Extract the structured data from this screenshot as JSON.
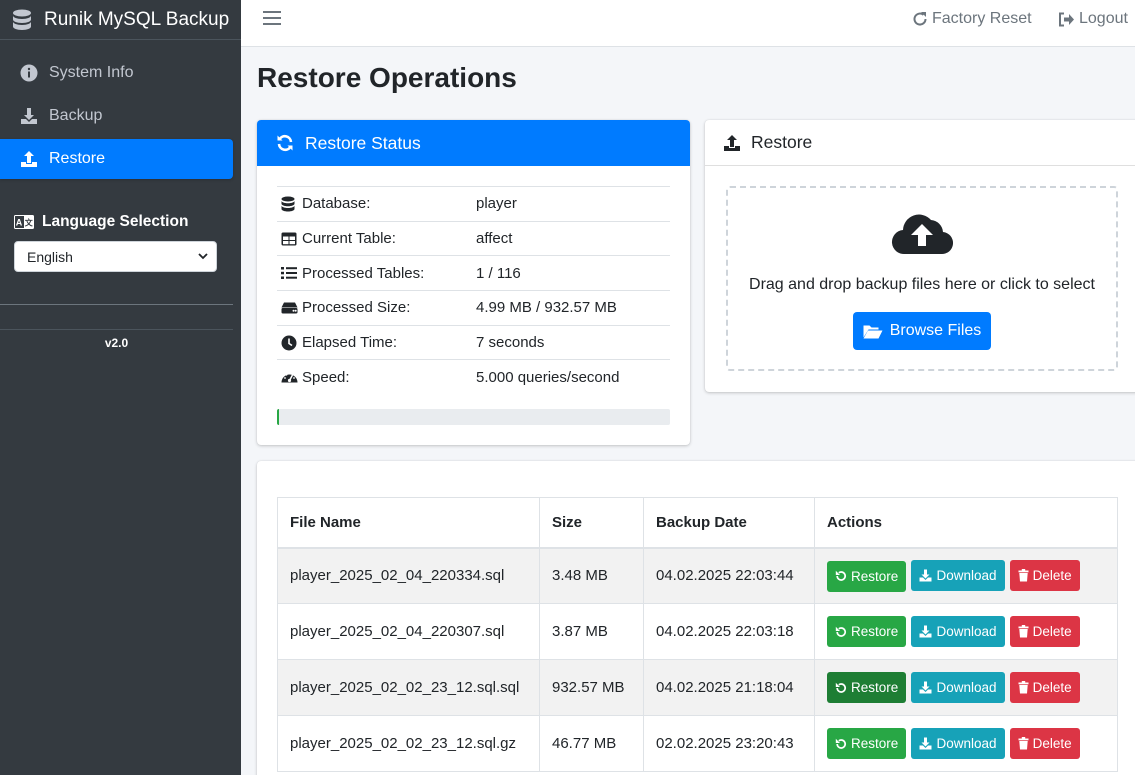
{
  "app": {
    "title": "Runik MySQL Backup",
    "version": "v2.0"
  },
  "sidebar": {
    "items": [
      {
        "label": "System Info",
        "icon": "info-circle-icon",
        "active": false
      },
      {
        "label": "Backup",
        "icon": "download-icon",
        "active": false
      },
      {
        "label": "Restore",
        "icon": "upload-icon",
        "active": true
      }
    ],
    "language_title": "Language Selection",
    "language_value": "English"
  },
  "topbar": {
    "factory_reset": "Factory Reset",
    "logout": "Logout"
  },
  "page_title": "Restore Operations",
  "status": {
    "header": "Restore Status",
    "rows": [
      {
        "label": "Database:",
        "value": "player",
        "icon": "database-icon"
      },
      {
        "label": "Current Table:",
        "value": "affect",
        "icon": "table-icon"
      },
      {
        "label": "Processed Tables:",
        "value": "1 / 116",
        "icon": "list-icon"
      },
      {
        "label": "Processed Size:",
        "value": "4.99 MB / 932.57 MB",
        "icon": "hdd-icon"
      },
      {
        "label": "Elapsed Time:",
        "value": "7 seconds",
        "icon": "clock-icon"
      },
      {
        "label": "Speed:",
        "value": "5.000 queries/second",
        "icon": "gauge-icon"
      }
    ],
    "progress_percent": 0.5,
    "progress_color": "#28a745"
  },
  "restore": {
    "header": "Restore",
    "drop_text": "Drag and drop backup files here or click to select",
    "browse_label": "Browse Files"
  },
  "files": {
    "columns": [
      "File Name",
      "Size",
      "Backup Date",
      "Actions"
    ],
    "rows": [
      {
        "name": "player_2025_02_04_220334.sql",
        "size": "3.48 MB",
        "date": "04.02.2025 22:03:44"
      },
      {
        "name": "player_2025_02_04_220307.sql",
        "size": "3.87 MB",
        "date": "04.02.2025 22:03:18"
      },
      {
        "name": "player_2025_02_02_23_12.sql.sql",
        "size": "932.57 MB",
        "date": "04.02.2025 21:18:04"
      },
      {
        "name": "player_2025_02_02_23_12.sql.gz",
        "size": "46.77 MB",
        "date": "02.02.2025 23:20:43"
      }
    ],
    "actions": {
      "restore": "Restore",
      "download": "Download",
      "delete": "Delete"
    }
  },
  "colors": {
    "primary": "#007bff",
    "success": "#28a745",
    "info": "#17a2b8",
    "danger": "#dc3545",
    "sidebar": "#343a40"
  }
}
